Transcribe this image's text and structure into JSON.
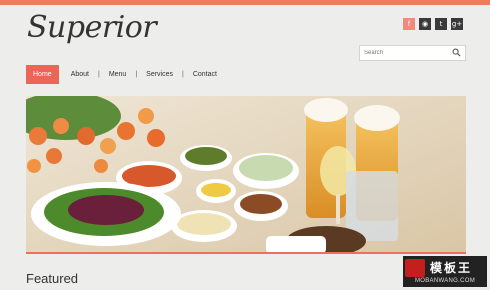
{
  "header": {
    "logo_text": "Superior",
    "search_placeholder": "Search",
    "social": [
      {
        "icon": "facebook-icon",
        "glyph": "f"
      },
      {
        "icon": "rss-icon",
        "glyph": "◉"
      },
      {
        "icon": "twitter-icon",
        "glyph": "t"
      },
      {
        "icon": "google-plus-icon",
        "glyph": "g+"
      }
    ]
  },
  "nav": {
    "items": [
      "Home",
      "About",
      "Menu",
      "Services",
      "Contact"
    ],
    "active": "Home"
  },
  "main": {
    "featured_heading": "Featured"
  },
  "watermark": {
    "cn": "模板王",
    "en": "MOBANWANG.COM"
  },
  "colors": {
    "accent": "#ea6656",
    "top_bar": "#ef7a66"
  }
}
